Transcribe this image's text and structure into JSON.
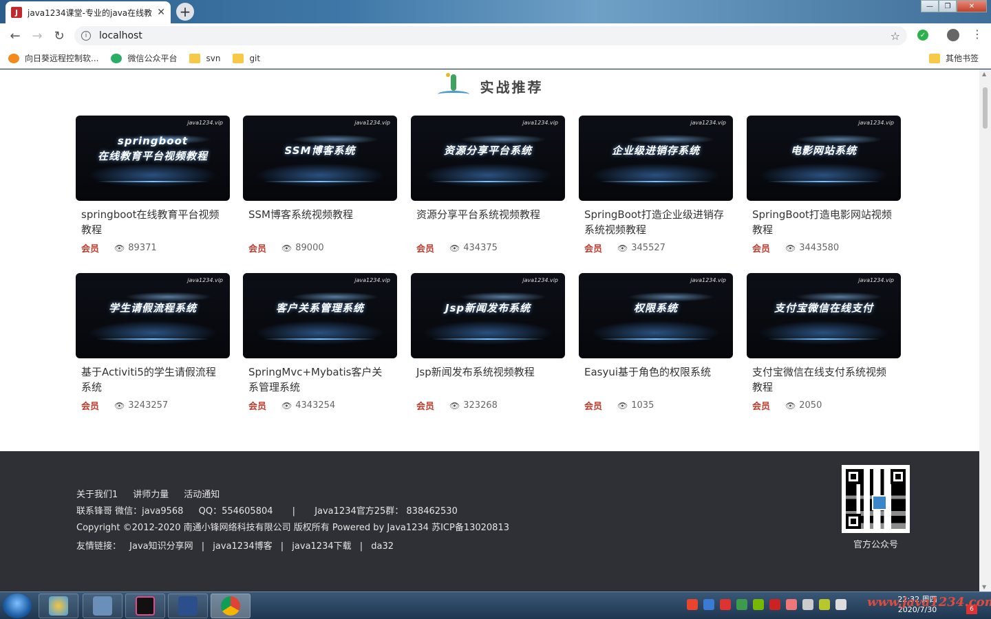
{
  "browser": {
    "tab_title": "java1234课堂-专业的java在线教",
    "favicon_letter": "J",
    "close_glyph": "✕",
    "new_tab_glyph": "+",
    "url": "localhost",
    "window_controls": [
      "—",
      "❐",
      "✕"
    ]
  },
  "bookmarks": [
    {
      "label": "向日葵远程控制软...",
      "icon": "sunflower-icon"
    },
    {
      "label": "微信公众平台",
      "icon": "wechat-icon"
    },
    {
      "label": "svn",
      "icon": "folder-icon"
    },
    {
      "label": "git",
      "icon": "folder-icon"
    }
  ],
  "bookmarks_other": "其他书签",
  "section": {
    "title": "实战推荐"
  },
  "thumb_watermark": "java1234.vip",
  "courses": [
    {
      "cover": "springboot\n在线教育平台视频教程",
      "title": "springboot在线教育平台视频教程",
      "badge": "会员",
      "views": "89371"
    },
    {
      "cover": "SSM博客系统",
      "title": "SSM博客系统视频教程",
      "badge": "会员",
      "views": "89000"
    },
    {
      "cover": "资源分享平台系统",
      "title": "资源分享平台系统视频教程",
      "badge": "会员",
      "views": "434375"
    },
    {
      "cover": "企业级进销存系统",
      "title": "SpringBoot打造企业级进销存系统视频教程",
      "badge": "会员",
      "views": "345527"
    },
    {
      "cover": "电影网站系统",
      "title": "SpringBoot打造电影网站视频教程",
      "badge": "会员",
      "views": "3443580"
    },
    {
      "cover": "学生请假流程系统",
      "title": "基于Activiti5的学生请假流程系统",
      "badge": "会员",
      "views": "3243257"
    },
    {
      "cover": "客户关系管理系统",
      "title": "SpringMvc+Mybatis客户关系管理系统",
      "badge": "会员",
      "views": "4343254"
    },
    {
      "cover": "Jsp新闻发布系统",
      "title": "Jsp新闻发布系统视频教程",
      "badge": "会员",
      "views": "323268"
    },
    {
      "cover": "权限系统",
      "title": "Easyui基于角色的权限系统",
      "badge": "会员",
      "views": "1035"
    },
    {
      "cover": "支付宝微信在线支付",
      "title": "支付宝微信在线支付系统视频教程",
      "badge": "会员",
      "views": "2050"
    }
  ],
  "footer": {
    "links": [
      "关于我们1",
      "讲师力量",
      "活动通知"
    ],
    "contact": "联系锋哥 微信：java9568",
    "qq": "QQ：554605804",
    "divider": "|",
    "group": "Java1234官方25群： 838462530",
    "copyright": "Copyright ©2012-2020 南通小锋网络科技有限公司 版权所有 Powered by Java1234 苏ICP备13020813",
    "friends_label": "友情链接：",
    "friends": [
      "Java知识分享网",
      "java1234博客",
      "java1234下载",
      "da32"
    ],
    "qr_label": "官方公众号"
  },
  "taskbar": {
    "clock_time": "22:32 周四",
    "clock_date": "2020/7/30",
    "notification_count": "6"
  },
  "page_watermark": "www.java1234.com",
  "colors": {
    "badge": "#c0392b",
    "footer_bg": "#2f2f36",
    "accent": "#4a9bd1"
  }
}
